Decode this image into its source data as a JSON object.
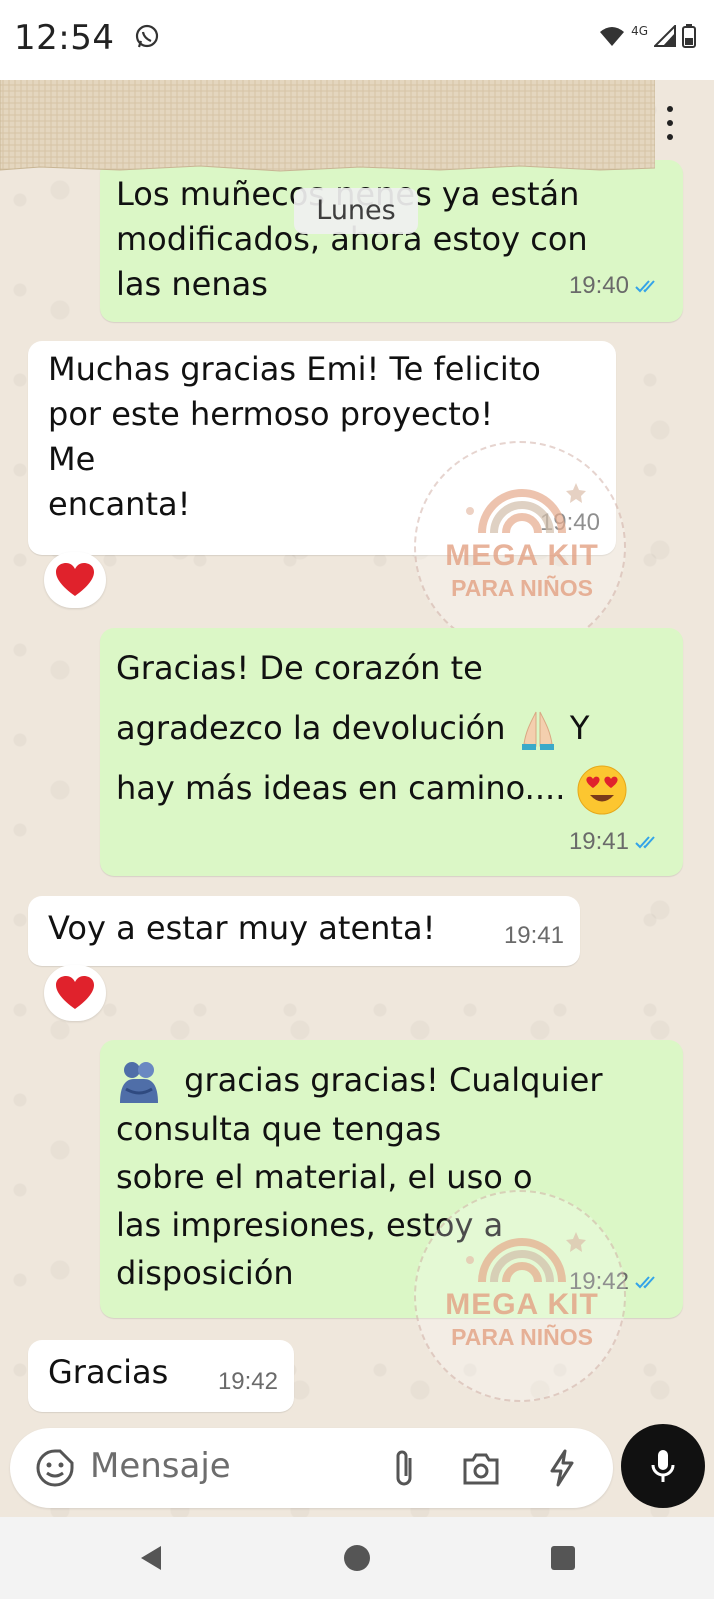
{
  "status_bar": {
    "time": "12:54",
    "network": "4G"
  },
  "date_chip": "Lunes",
  "messages": [
    {
      "direction": "outgoing",
      "lines": [
        "Los muñecos nenes ya están",
        "modificados, ahora estoy con",
        "las nenas"
      ],
      "time": "19:40",
      "read": true
    },
    {
      "direction": "incoming",
      "lines": [
        "Muchas gracias Emi! Te felicito",
        "por este hermoso proyecto!",
        "Me",
        "encanta!"
      ],
      "time": "19:40",
      "reaction": "heart-emoji"
    },
    {
      "direction": "outgoing",
      "lines": [
        "Gracias! De corazón te",
        "agradezco la devolución",
        "hay más ideas en camino...."
      ],
      "inline_emojis": [
        "folded-hands-emoji",
        "heart-eyes-emoji"
      ],
      "after_emoji_text": "Y",
      "time": "19:41",
      "read": true
    },
    {
      "direction": "incoming",
      "lines": [
        "Voy a estar muy atenta!"
      ],
      "time": "19:41",
      "reaction": "heart-emoji"
    },
    {
      "direction": "outgoing",
      "leading_emoji": "people-hugging-emoji",
      "lines": [
        "gracias gracias! Cualquier",
        "consulta que tengas",
        "sobre el material, el uso o",
        "las impresiones, estoy a",
        "disposición"
      ],
      "time": "19:42",
      "read": true
    },
    {
      "direction": "incoming",
      "lines": [
        "Gracias"
      ],
      "time": "19:42"
    }
  ],
  "watermark": {
    "line1": "MEGA KIT",
    "line2": "PARA NIÑOS"
  },
  "input": {
    "placeholder": "Mensaje"
  },
  "icons": {
    "emoji_button": "sticker-smiley-icon",
    "attach": "paperclip-icon",
    "camera": "camera-icon",
    "quick": "lightning-icon",
    "mic": "microphone-icon"
  },
  "colors": {
    "outgoing_bubble": "#dbf7c6",
    "incoming_bubble": "#ffffff",
    "read_ticks": "#34a3e8",
    "chat_background": "#efe7dc",
    "mic_button": "#111111"
  }
}
